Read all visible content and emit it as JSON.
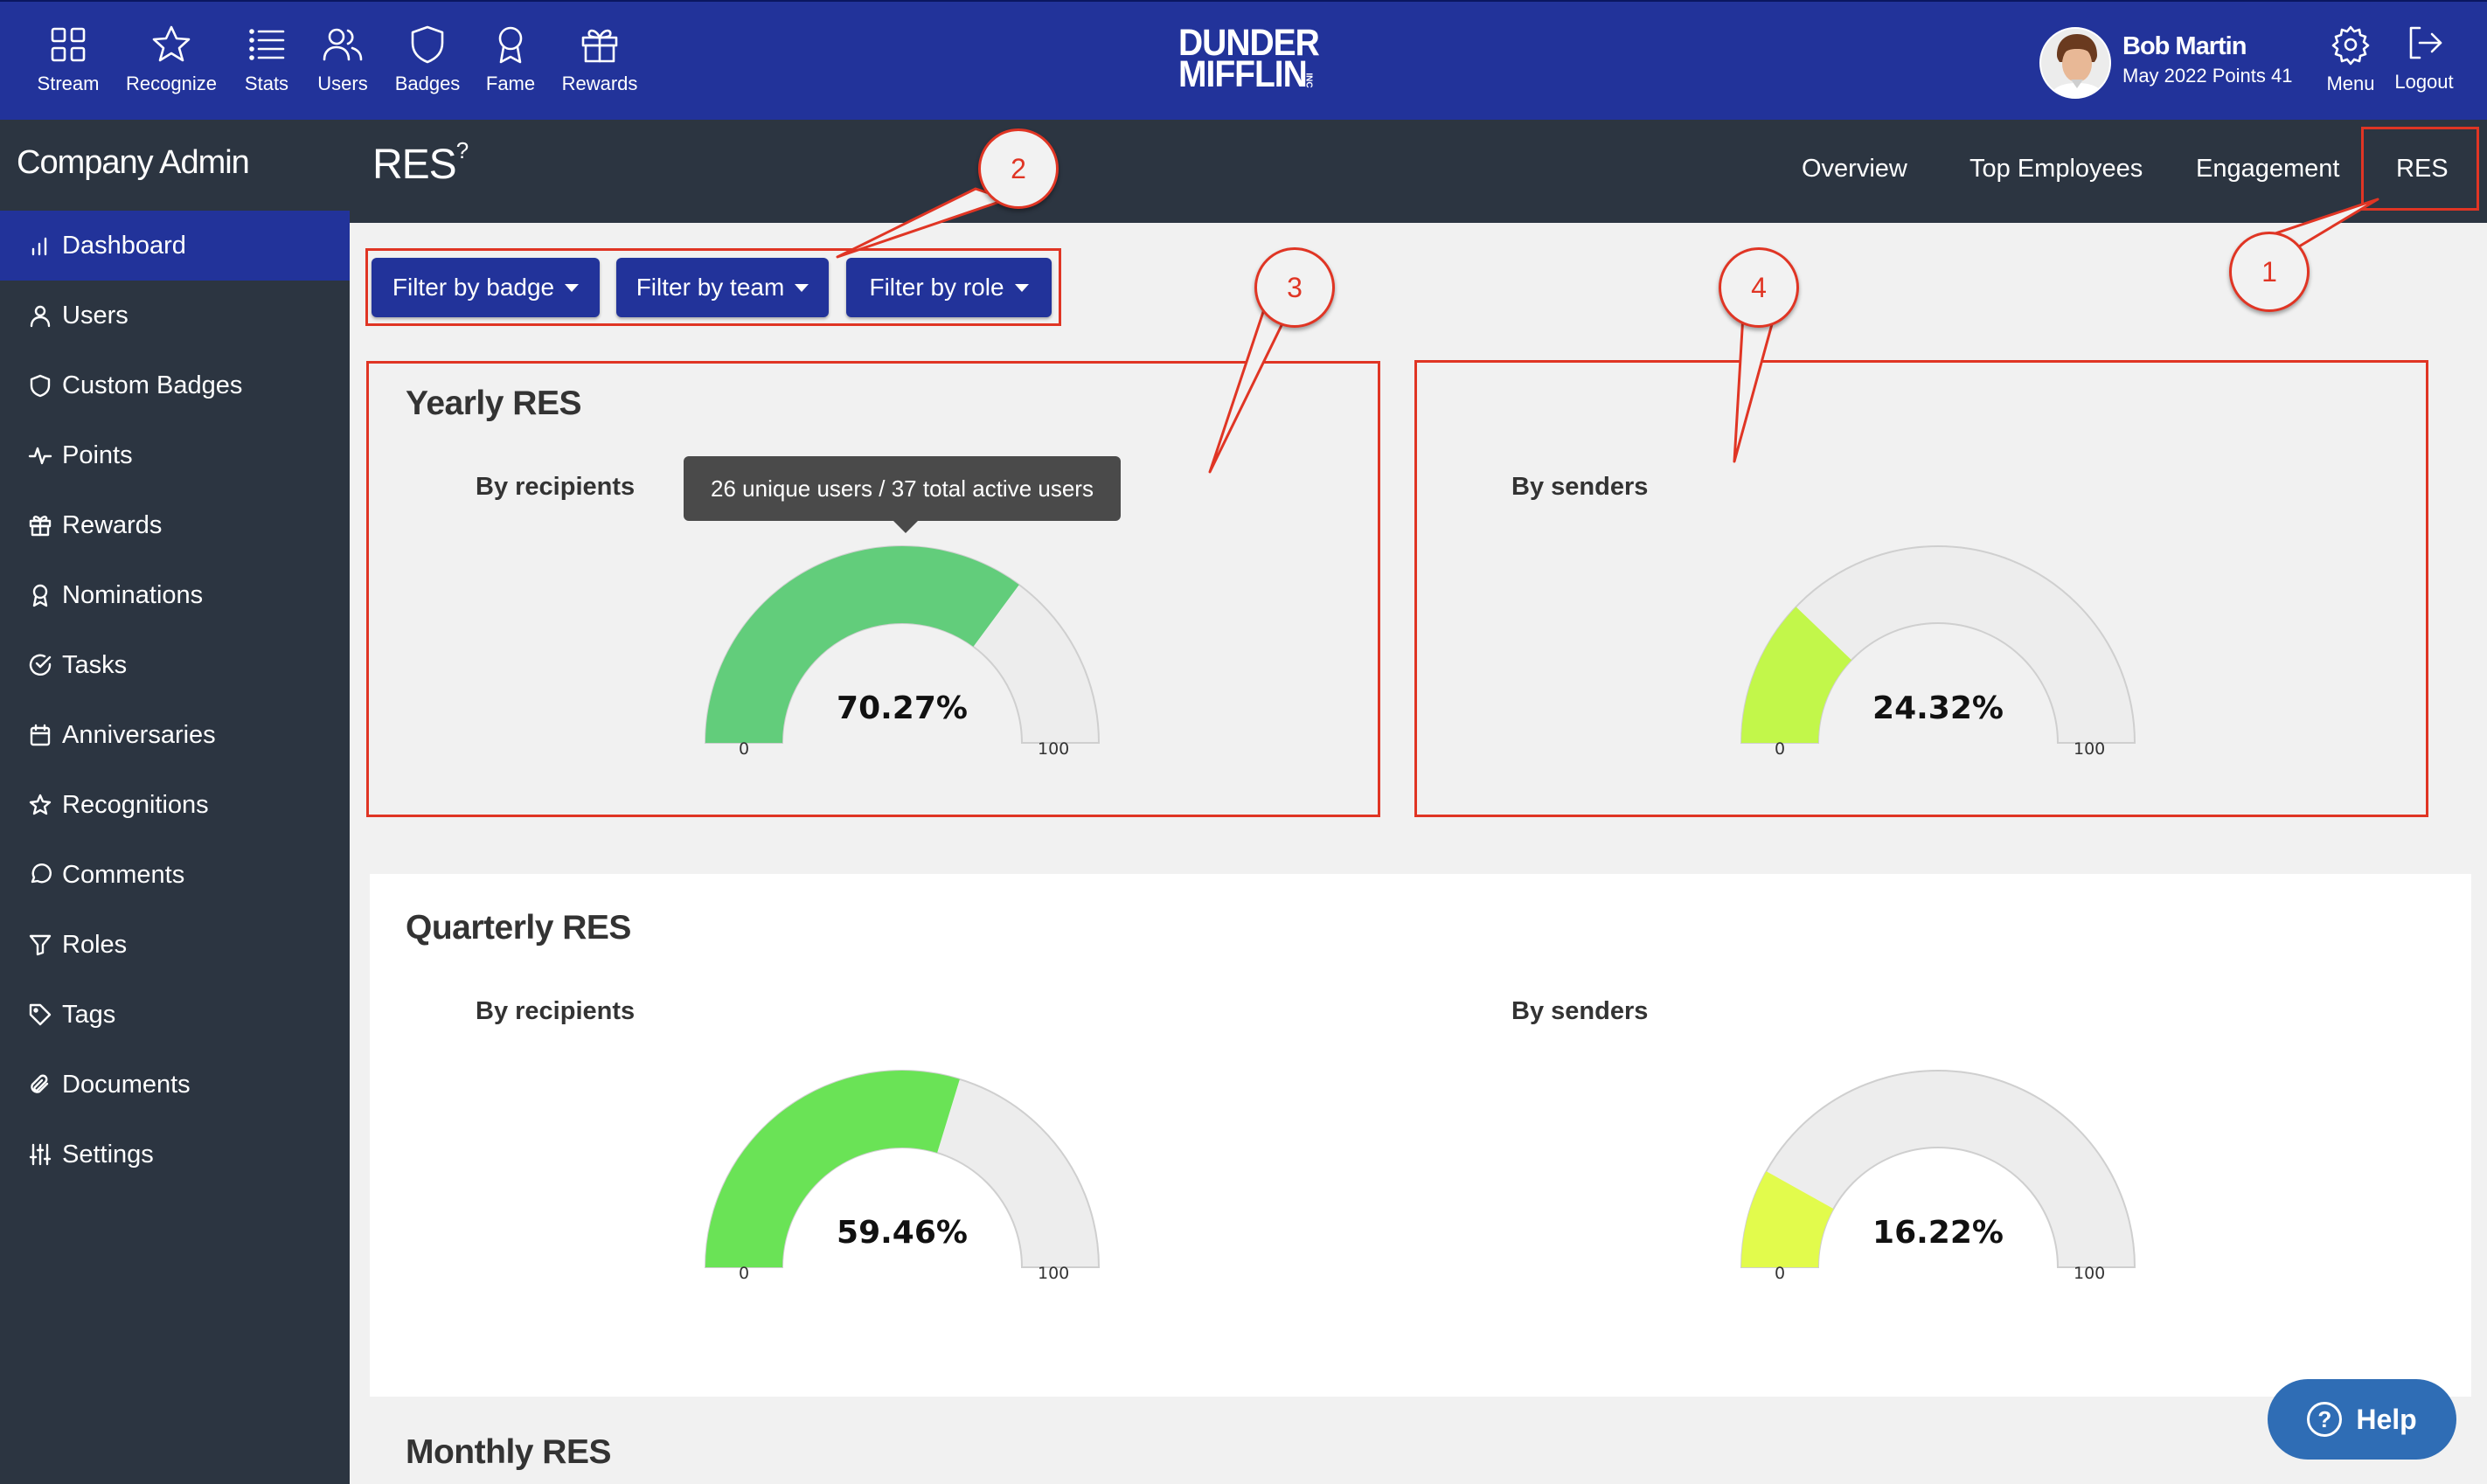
{
  "topnav": {
    "items": [
      {
        "label": "Stream",
        "icon": "grid-icon"
      },
      {
        "label": "Recognize",
        "icon": "star-icon"
      },
      {
        "label": "Stats",
        "icon": "list-icon"
      },
      {
        "label": "Users",
        "icon": "users-icon"
      },
      {
        "label": "Badges",
        "icon": "shield-icon"
      },
      {
        "label": "Fame",
        "icon": "ribbon-icon"
      },
      {
        "label": "Rewards",
        "icon": "gift-icon"
      }
    ],
    "logo_line1": "DUNDER",
    "logo_line2": "MIFFLIN",
    "logo_small": "INC",
    "user_name": "Bob Martin",
    "user_points": "May 2022 Points 41",
    "menu_label": "Menu",
    "logout_label": "Logout"
  },
  "sidebar": {
    "title": "Company Admin",
    "items": [
      {
        "label": "Dashboard",
        "icon": "bar-chart-icon",
        "active": true
      },
      {
        "label": "Users",
        "icon": "user-icon"
      },
      {
        "label": "Custom Badges",
        "icon": "shield-icon"
      },
      {
        "label": "Points",
        "icon": "activity-icon"
      },
      {
        "label": "Rewards",
        "icon": "gift-icon"
      },
      {
        "label": "Nominations",
        "icon": "ribbon-icon"
      },
      {
        "label": "Tasks",
        "icon": "check-circle-icon"
      },
      {
        "label": "Anniversaries",
        "icon": "calendar-icon"
      },
      {
        "label": "Recognitions",
        "icon": "star-icon"
      },
      {
        "label": "Comments",
        "icon": "comment-icon"
      },
      {
        "label": "Roles",
        "icon": "filter-icon"
      },
      {
        "label": "Tags",
        "icon": "tag-icon"
      },
      {
        "label": "Documents",
        "icon": "paperclip-icon"
      },
      {
        "label": "Settings",
        "icon": "sliders-icon"
      }
    ]
  },
  "header": {
    "title": "RES",
    "title_sup": "?",
    "tabs": [
      "Overview",
      "Top Employees",
      "Engagement",
      "RES"
    ],
    "active_tab": "RES"
  },
  "filters": [
    "Filter by badge",
    "Filter by team",
    "Filter by role"
  ],
  "callouts": [
    "1",
    "2",
    "3",
    "4"
  ],
  "colors": {
    "nav": "#22339a",
    "sidebar": "#2c3541",
    "annotation": "#e03524",
    "help": "#2f6db5"
  },
  "sections": [
    {
      "title": "Yearly RES",
      "recipients": {
        "label": "By recipients",
        "value_text": "70.27%",
        "value": 70.27,
        "color": "#62cd7b",
        "min": "0",
        "max": "100",
        "tooltip": "26 unique users / 37 total active users"
      },
      "senders": {
        "label": "By senders",
        "value_text": "24.32%",
        "value": 24.32,
        "color": "#c2f74a",
        "min": "0",
        "max": "100"
      }
    },
    {
      "title": "Quarterly RES",
      "recipients": {
        "label": "By recipients",
        "value_text": "59.46%",
        "value": 59.46,
        "color": "#6ae356",
        "min": "0",
        "max": "100"
      },
      "senders": {
        "label": "By senders",
        "value_text": "16.22%",
        "value": 16.22,
        "color": "#e2fb4c",
        "min": "0",
        "max": "100"
      }
    },
    {
      "title": "Monthly RES"
    }
  ],
  "help_label": "Help"
}
